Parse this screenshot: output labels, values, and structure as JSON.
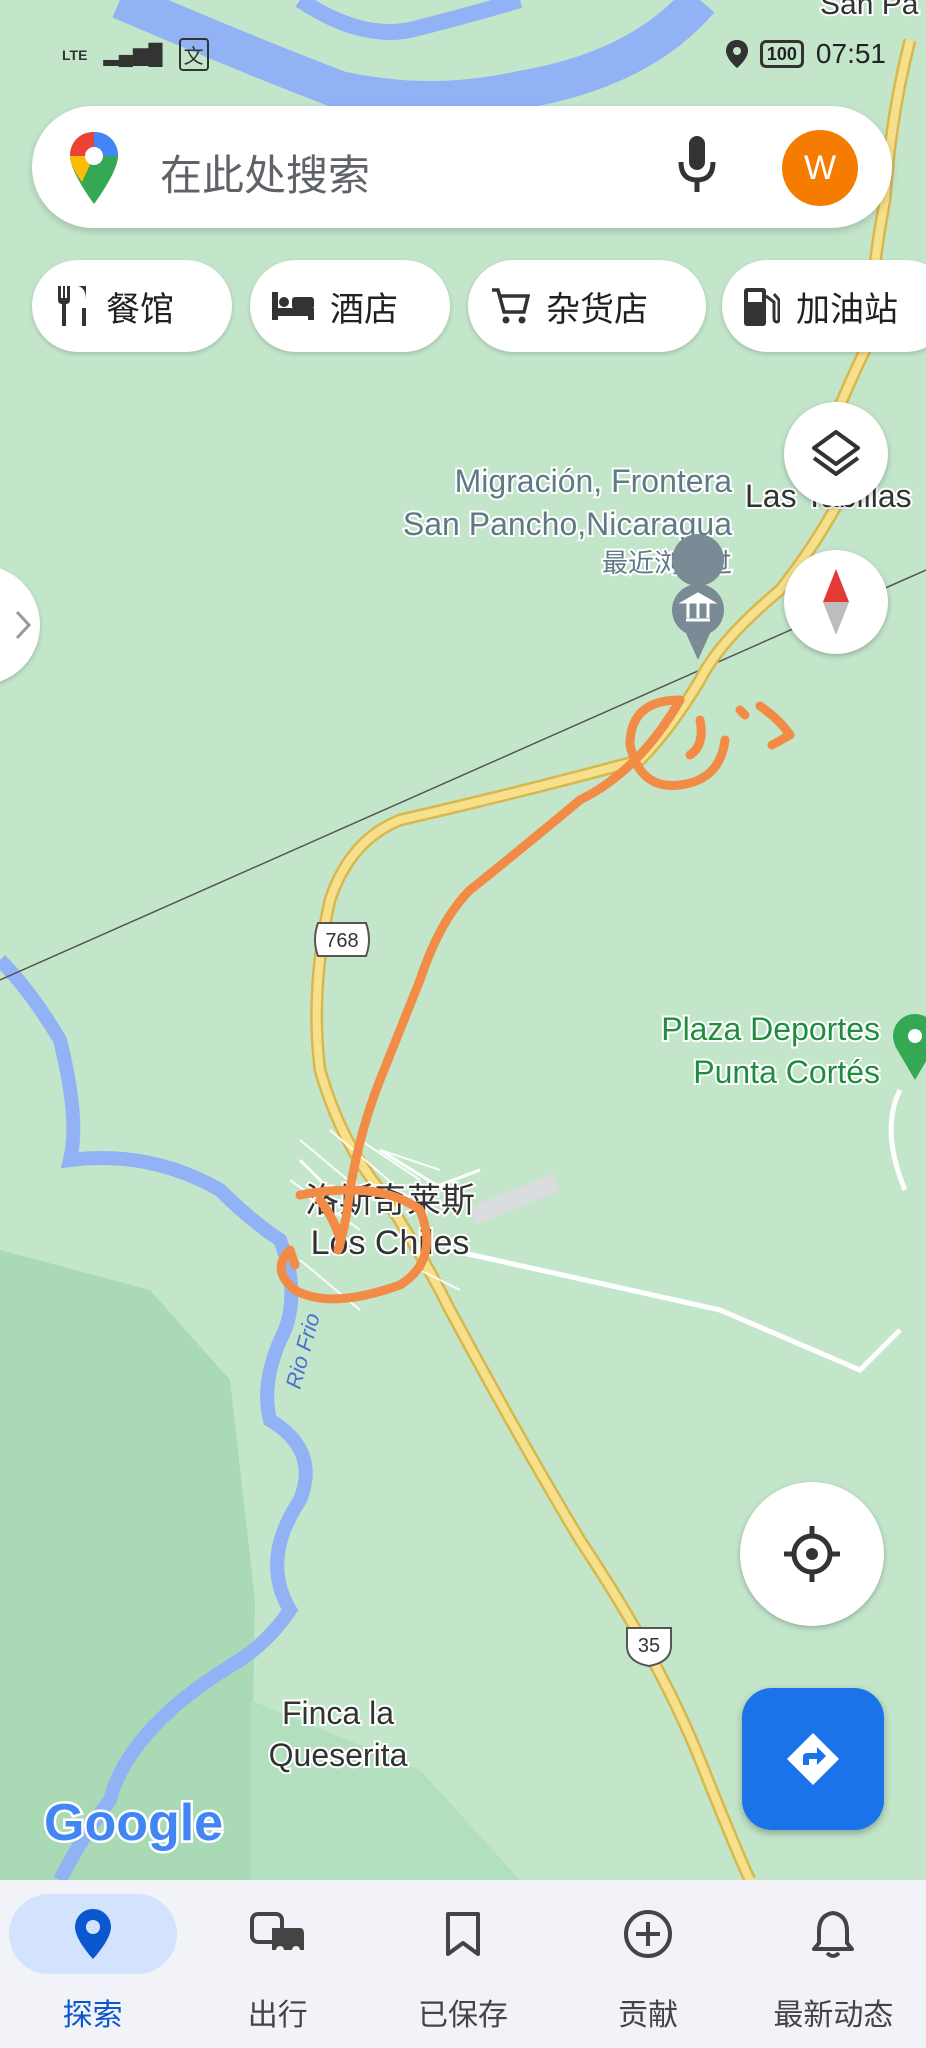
{
  "status_bar": {
    "network": "LTE",
    "battery": "100",
    "time": "07:51"
  },
  "search": {
    "placeholder": "在此处搜索",
    "avatar_letter": "W"
  },
  "categories": [
    {
      "label": "餐馆",
      "icon": "restaurant-icon"
    },
    {
      "label": "酒店",
      "icon": "hotel-icon"
    },
    {
      "label": "杂货店",
      "icon": "cart-icon"
    },
    {
      "label": "加油站",
      "icon": "gas-station-icon"
    }
  ],
  "map": {
    "places": {
      "border": {
        "line1": "Migración, Frontera",
        "line2": "San Pancho,Nicaragua",
        "sub": "最近浏览过"
      },
      "tabillas": "Las Tabillas",
      "top_right": "San Pa",
      "plaza": {
        "line1": "Plaza Deportes",
        "line2": "Punta Cortés"
      },
      "town": {
        "line1": "洛斯奇莱斯",
        "line2": "Los Chiles"
      },
      "finca": {
        "line1": "Finca la",
        "line2": "Queserita"
      },
      "river": "Rio Frio"
    },
    "road_shields": [
      "768",
      "35"
    ],
    "attribution": "Google",
    "colors": {
      "land": "#c3e6cb",
      "water": "#91b3f5",
      "road": "#f5d36c",
      "annotation": "#f28b46"
    }
  },
  "nav": [
    {
      "label": "探索",
      "icon": "explore-pin-icon",
      "active": true
    },
    {
      "label": "出行",
      "icon": "commute-icon",
      "active": false
    },
    {
      "label": "已保存",
      "icon": "bookmark-icon",
      "active": false
    },
    {
      "label": "贡献",
      "icon": "add-circle-icon",
      "active": false
    },
    {
      "label": "最新动态",
      "icon": "bell-icon",
      "active": false
    }
  ]
}
